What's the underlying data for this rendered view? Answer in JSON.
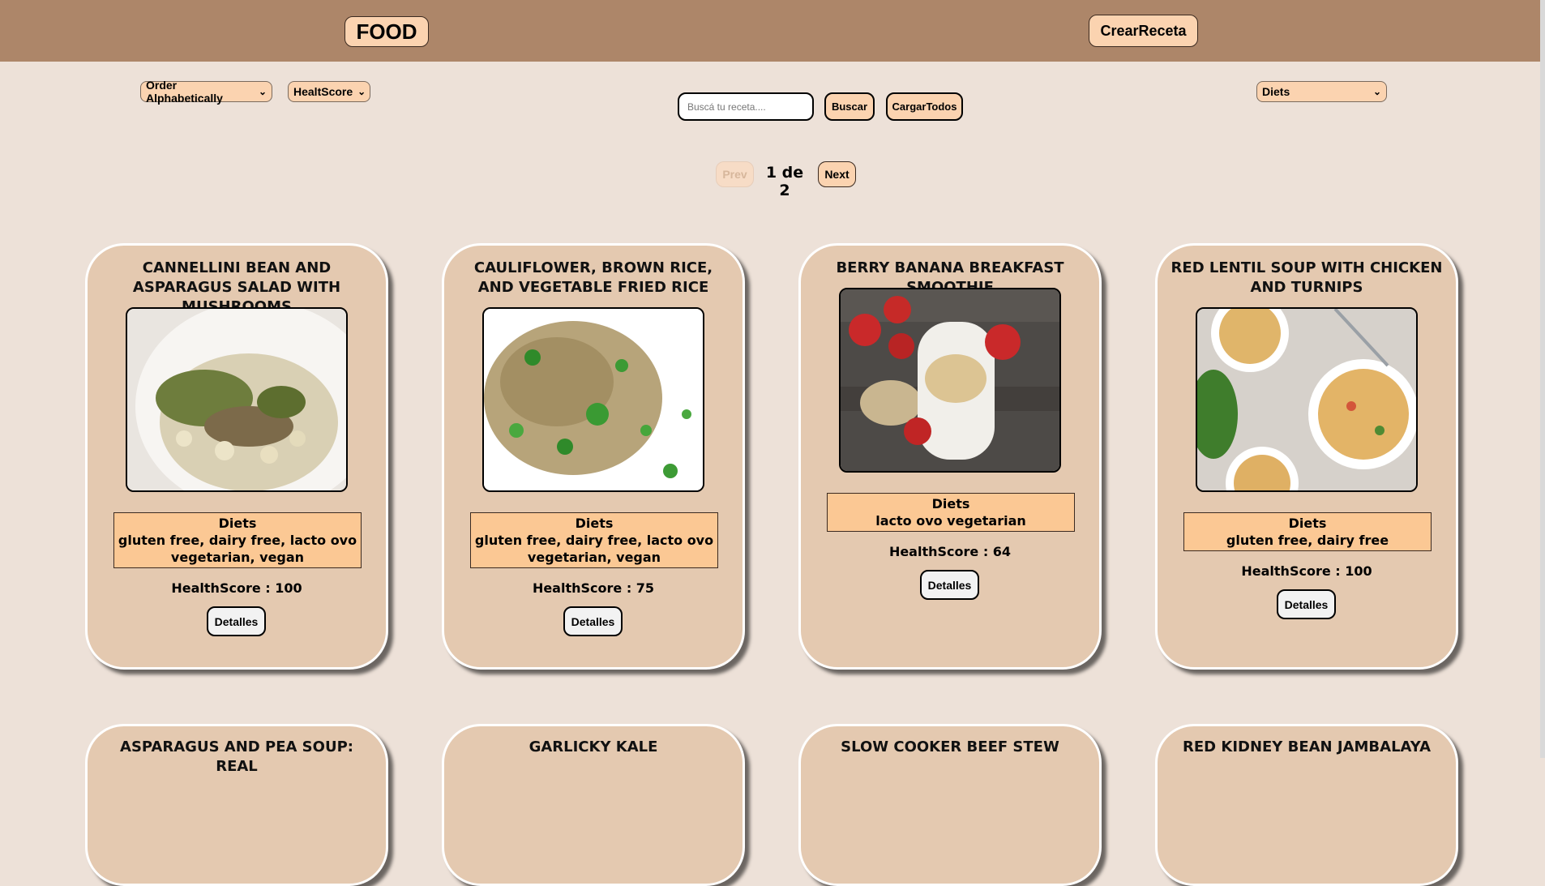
{
  "header": {
    "logo": "FOOD",
    "create_label": "CrearReceta"
  },
  "filters": {
    "order_alpha": "Order Alphabetically",
    "order_health": "HealtScore",
    "diets": "Diets",
    "search_placeholder": "Buscá tu receta....",
    "search_button": "Buscar",
    "load_all_button": "CargarTodos"
  },
  "pager": {
    "prev": "Prev",
    "indicator": "1 de 2",
    "next": "Next"
  },
  "cards": [
    {
      "title": "CANNELLINI BEAN AND ASPARAGUS SALAD WITH MUSHROOMS",
      "diets_label": "Diets",
      "diets": "gluten free, dairy free, lacto ovo vegetarian, vegan",
      "health": "HealthScore : 100",
      "details": "Detalles"
    },
    {
      "title": "CAULIFLOWER, BROWN RICE, AND VEGETABLE FRIED RICE",
      "diets_label": "Diets",
      "diets": "gluten free, dairy free, lacto ovo vegetarian, vegan",
      "health": "HealthScore : 75",
      "details": "Detalles"
    },
    {
      "title": "BERRY BANANA BREAKFAST SMOOTHIE",
      "diets_label": "Diets",
      "diets": "lacto ovo vegetarian",
      "health": "HealthScore : 64",
      "details": "Detalles"
    },
    {
      "title": "RED LENTIL SOUP WITH CHICKEN AND TURNIPS",
      "diets_label": "Diets",
      "diets": "gluten free, dairy free",
      "health": "HealthScore : 100",
      "details": "Detalles"
    }
  ],
  "cards_row2": [
    {
      "title": "ASPARAGUS AND PEA SOUP: REAL"
    },
    {
      "title": "GARLICKY KALE"
    },
    {
      "title": "SLOW COOKER BEEF STEW"
    },
    {
      "title": "RED KIDNEY BEAN JAMBALAYA"
    }
  ]
}
